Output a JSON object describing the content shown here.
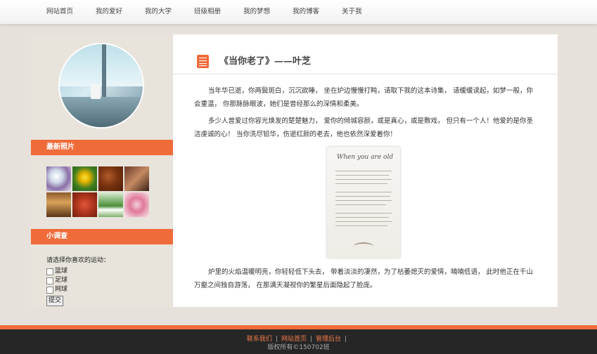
{
  "nav": {
    "items": [
      "网站首页",
      "我的爱好",
      "我的大学",
      "班级相册",
      "我的梦想",
      "我的博客",
      "关于我"
    ]
  },
  "sidebar": {
    "photos_title": "最新照片",
    "survey_title": "小调查",
    "survey_question": "请选择你喜欢的运动：",
    "options": [
      "篮球",
      "足球",
      "网球"
    ],
    "submit_label": "提交"
  },
  "article": {
    "title": "《当你老了》——叶芝",
    "paragraphs": [
      "当年华已逝，你两鬓斑白，沉沉欲睡， 坐在炉边慢慢打盹，请取下我的这本诗集， 请缓缓读起，如梦一般，你会重温， 你那脉脉眼波，她们是曾经那么的深情和柔美。",
      "多少人曾爱过你容光焕发的楚楚魅力， 爱你的倾城容颜，或是真心，或是敷戏， 但只有一个人！他爱的是你圣洁虔诚的心！ 当你洗尽铅华，伤逝红颜的老去，他也依然深爱着你！",
      "炉里的火焰温暖明亮，你轻轻低下头去， 带着淡淡的凄然，为了枯萎熄灭的爱情，喃喃低语， 此时他正在千山万壑之间独自游荡， 在那满天凝视你的繁星后面隐起了脸庞。"
    ],
    "poem_image_title": "When you are old"
  },
  "footer": {
    "links": [
      "联系我们",
      "网站首页",
      "管理后台"
    ],
    "copyright": "版权所有©150702班"
  },
  "colors": {
    "accent": "#f06b3a",
    "footer_bg": "#262626"
  }
}
